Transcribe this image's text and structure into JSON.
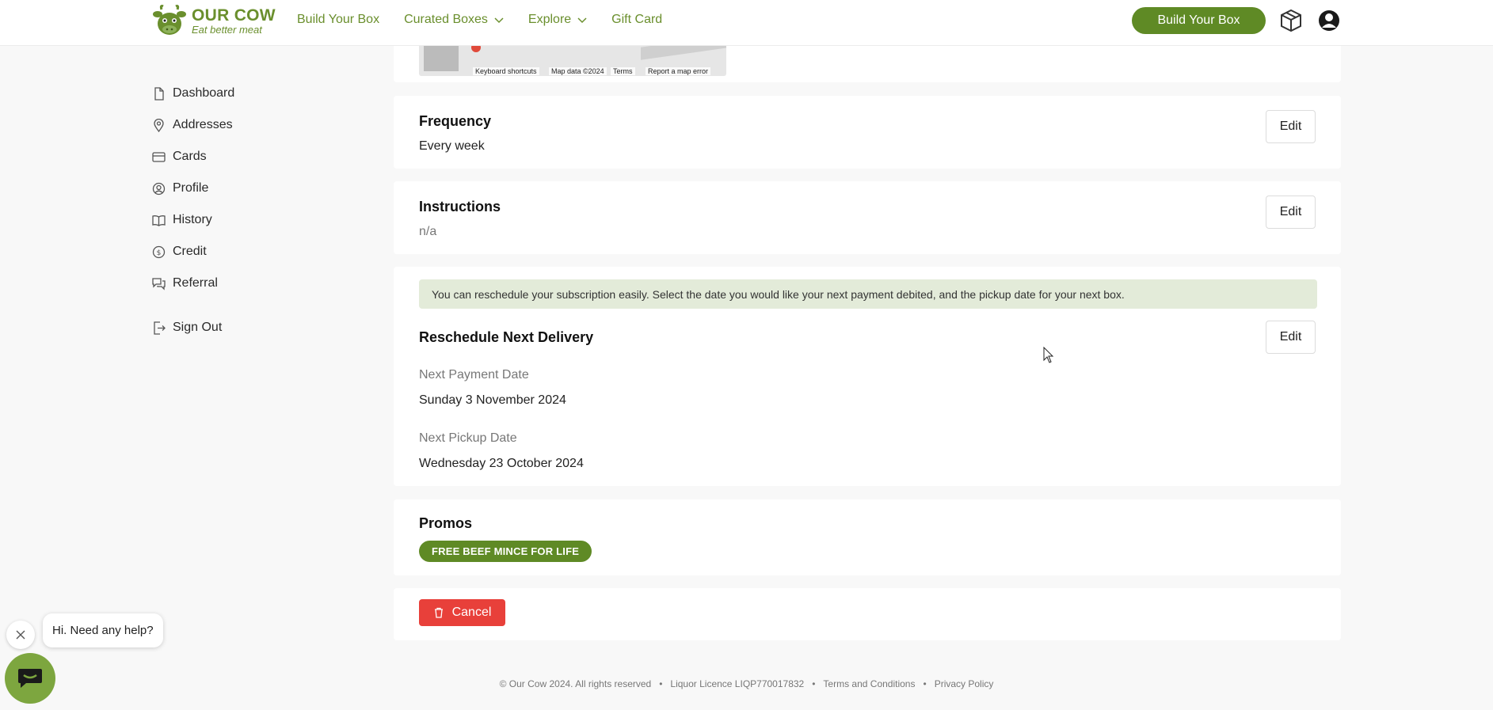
{
  "header": {
    "logo_title": "OUR COW",
    "logo_subtitle": "Eat better meat",
    "nav": [
      {
        "label": "Build Your Box",
        "has_dropdown": false
      },
      {
        "label": "Curated Boxes",
        "has_dropdown": true
      },
      {
        "label": "Explore",
        "has_dropdown": true
      },
      {
        "label": "Gift Card",
        "has_dropdown": false
      }
    ],
    "cta_label": "Build Your Box",
    "icons": [
      "box-icon",
      "account-icon"
    ]
  },
  "sidebar": {
    "items": [
      {
        "label": "Dashboard",
        "icon": "document-icon"
      },
      {
        "label": "Addresses",
        "icon": "location-pin-icon"
      },
      {
        "label": "Cards",
        "icon": "credit-card-icon"
      },
      {
        "label": "Profile",
        "icon": "user-circle-icon"
      },
      {
        "label": "History",
        "icon": "book-icon"
      },
      {
        "label": "Credit",
        "icon": "dollar-circle-icon"
      },
      {
        "label": "Referral",
        "icon": "chat-bubbles-icon"
      }
    ],
    "sign_out": {
      "label": "Sign Out",
      "icon": "sign-out-icon"
    }
  },
  "map": {
    "keyboard_shortcuts": "Keyboard shortcuts",
    "map_data": "Map data ©2024",
    "terms": "Terms",
    "report": "Report a map error"
  },
  "frequency": {
    "title": "Frequency",
    "value": "Every week",
    "edit_label": "Edit"
  },
  "instructions": {
    "title": "Instructions",
    "value": "n/a",
    "edit_label": "Edit"
  },
  "reschedule": {
    "notice": "You can reschedule your subscription easily. Select the date you would like your next payment debited, and the pickup date for your next box.",
    "title": "Reschedule Next Delivery",
    "edit_label": "Edit",
    "payment_label": "Next Payment Date",
    "payment_value": "Sunday 3 November 2024",
    "pickup_label": "Next Pickup Date",
    "pickup_value": "Wednesday 23 October 2024"
  },
  "promos": {
    "title": "Promos",
    "code": "FREE BEEF MINCE FOR LIFE"
  },
  "cancel_label": "Cancel",
  "footer": {
    "copyright": "© Our Cow 2024. All rights reserved",
    "licence": "Liquor Licence LIQP770017832",
    "terms": "Terms and Conditions",
    "privacy": "Privacy Policy"
  },
  "chat": {
    "greeting": "Hi. Need any help?"
  },
  "colors": {
    "brand_green": "#5f8a25",
    "danger": "#e8403a",
    "notice_bg": "#e3ebd9"
  }
}
